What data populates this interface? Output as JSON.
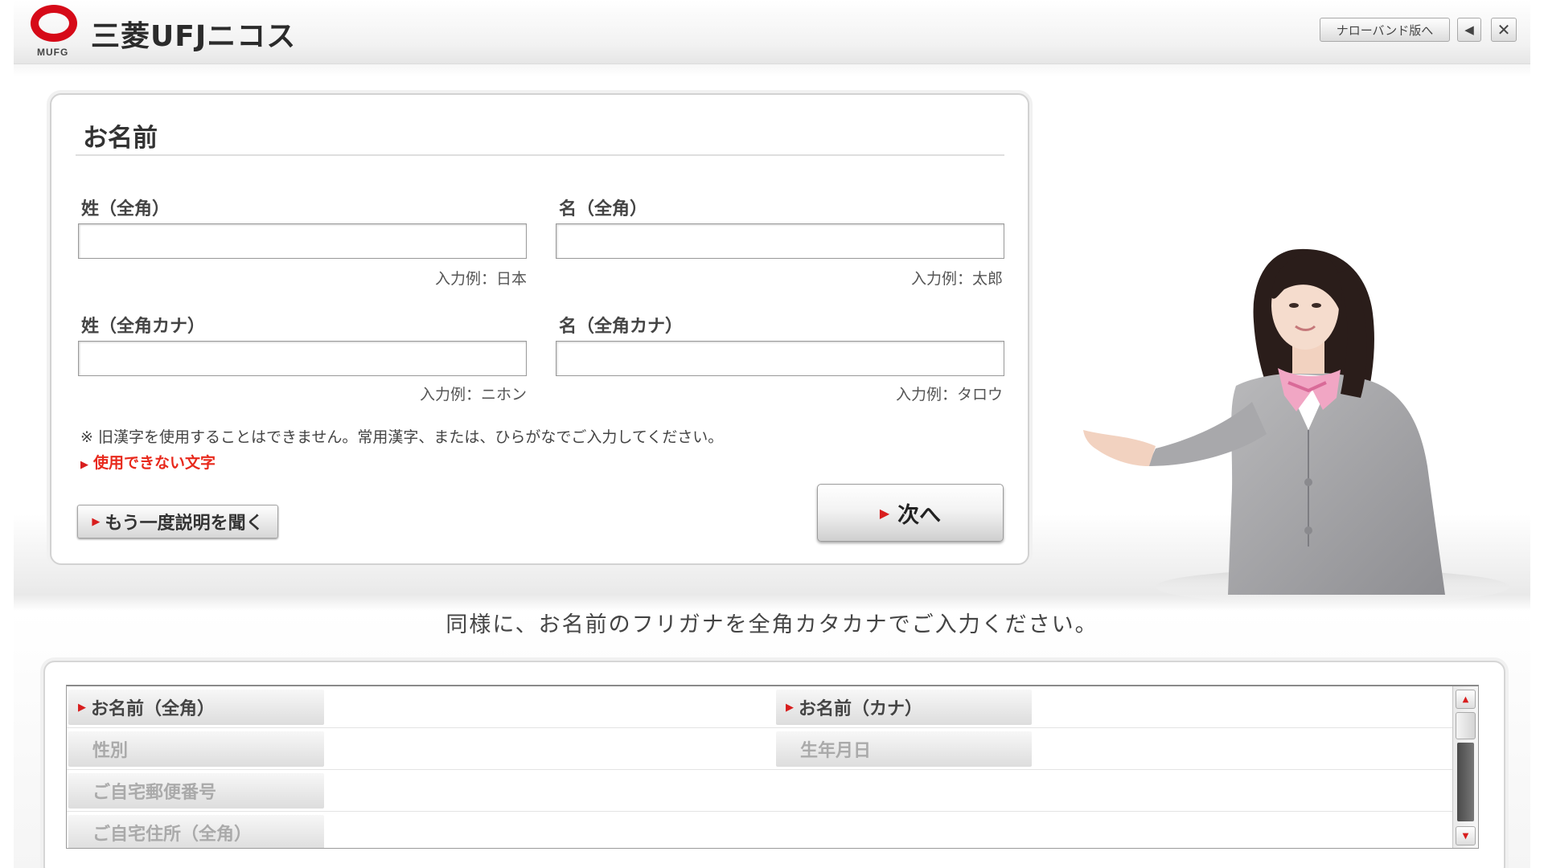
{
  "header": {
    "logo_sub": "MUFG",
    "brand": "三菱UFJニコス",
    "narrowband_label": "ナローバンド版へ",
    "back_label": "◀",
    "close_label": "✕"
  },
  "form": {
    "title": "お名前",
    "last_name_kanji_label": "姓（全角）",
    "first_name_kanji_label": "名（全角）",
    "last_name_kanji_value": "",
    "first_name_kanji_value": "",
    "last_name_kanji_hint": "入力例：日本",
    "first_name_kanji_hint": "入力例：太郎",
    "last_name_kana_label": "姓（全角カナ）",
    "first_name_kana_label": "名（全角カナ）",
    "last_name_kana_value": "",
    "first_name_kana_value": "",
    "last_name_kana_hint": "入力例：ニホン",
    "first_name_kana_hint": "入力例：タロウ",
    "notice": "※ 旧漢字を使用することはできません。常用漢字、または、ひらがなでご入力してください。",
    "unusable_chars_link": "使用できない文字",
    "replay_button": "もう一度説明を聞く",
    "next_button": "次へ"
  },
  "instruction": "同様に、お名前のフリガナを全角カタカナでご入力ください。",
  "progress": {
    "rows": [
      {
        "left": "お名前（全角）",
        "left_active": true,
        "right": "お名前（カナ）",
        "right_active": true
      },
      {
        "left": "性別",
        "left_active": false,
        "right": "生年月日",
        "right_active": false
      },
      {
        "left": "ご自宅郵便番号",
        "left_active": false,
        "right": "",
        "right_active": false
      },
      {
        "left": "ご自宅住所（全角）",
        "left_active": false,
        "right": "",
        "right_active": false
      }
    ]
  },
  "colors": {
    "brand_red": "#d60a18",
    "link_red": "#e8291c"
  }
}
